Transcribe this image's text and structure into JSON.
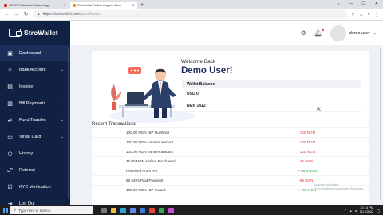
{
  "browser": {
    "tabs": [
      {
        "label": "USSD Collection Technology",
        "color": "#d93025",
        "active": false
      },
      {
        "label": "StroWallet Online Crypto, Secu",
        "color": "#f29900",
        "active": true
      }
    ],
    "new_tab": "+",
    "url_host": "https://strowallet.com",
    "url_path": "/user/home"
  },
  "sidebar": {
    "brand": "StroWallet",
    "items": [
      {
        "label": "Dashboard",
        "icon": "dashboard-icon",
        "glyph": "▣",
        "chevron": false,
        "active": true
      },
      {
        "label": "Bank Account",
        "icon": "bank-icon",
        "glyph": "⌂",
        "chevron": true,
        "active": false
      },
      {
        "label": "Invoice",
        "icon": "invoice-icon",
        "glyph": "▤",
        "chevron": false,
        "active": false
      },
      {
        "label": "Bill Payments",
        "icon": "bill-icon",
        "glyph": "▥",
        "chevron": true,
        "active": false
      },
      {
        "label": "Fund Transfer",
        "icon": "transfer-icon",
        "glyph": "⇄",
        "chevron": true,
        "active": false
      },
      {
        "label": "Virual Card",
        "icon": "card-icon",
        "glyph": "▭",
        "chevron": true,
        "active": false
      },
      {
        "label": "History",
        "icon": "history-icon",
        "glyph": "◷",
        "chevron": false,
        "active": false
      },
      {
        "label": "Referral",
        "icon": "referral-icon",
        "glyph": "☍",
        "chevron": false,
        "active": false
      },
      {
        "label": "KYC Verification",
        "icon": "kyc-icon",
        "glyph": "☑",
        "chevron": false,
        "active": false
      },
      {
        "label": "Log Out",
        "icon": "logout-icon",
        "glyph": "⇥",
        "chevron": false,
        "active": false
      }
    ]
  },
  "header": {
    "user_name": "demo user"
  },
  "main": {
    "welcome": "Welcome Back",
    "greeting": "Demo User!",
    "wallet_header": "Wallet Balance",
    "balances": [
      "USD 0",
      "NGN 1412"
    ],
    "recent_title": "Recent Transactions",
    "transactions": [
      {
        "desc": "100.00 NGN NIP OutWord",
        "amount": "- 100 NGN",
        "type": "debit"
      },
      {
        "desc": "100.00 NGN transfer amount",
        "amount": "- 100 NGN",
        "type": "debit"
      },
      {
        "desc": "100.00 NGN transfer amount",
        "amount": "- 100 NGN",
        "type": "debit"
      },
      {
        "desc": "46.00 NGN Airtime Purchased",
        "amount": "- 46 NGN",
        "type": "debit"
      },
      {
        "desc": "Received From API",
        "amount": "+ 99.5 NGN",
        "type": "credit"
      },
      {
        "desc": "99 NGN Paid Payment",
        "amount": "- 99 NGN",
        "type": "debit"
      },
      {
        "desc": "100.00 NGN NIP Inward",
        "amount": "+ 100 NGN",
        "type": "credit"
      }
    ],
    "watermark_line1": "Activate Windows",
    "watermark_line2": "Go to Settings to activate Windows."
  },
  "taskbar": {
    "search_placeholder": "Type here to search",
    "time": "12:14 PM",
    "date": "11/1/2022"
  },
  "colors": {
    "sidebar_bg": "#112143",
    "greeting": "#1d2c5b",
    "debit": "#e03a3a",
    "credit": "#2e9c4a"
  }
}
